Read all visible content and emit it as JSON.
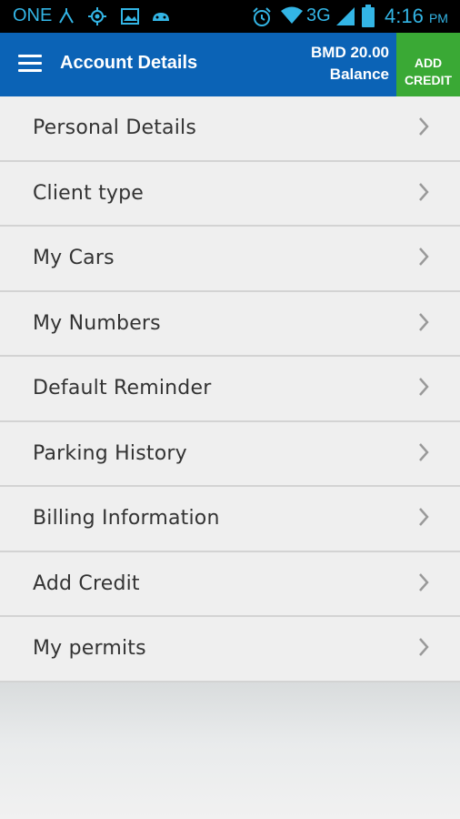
{
  "status_bar": {
    "carrier": "ONE",
    "network": "3G",
    "time": "4:16",
    "ampm": "PM"
  },
  "header": {
    "title": "Account Details",
    "balance_amount": "BMD 20.00",
    "balance_label": "Balance",
    "add_credit_line1": "ADD",
    "add_credit_line2": "CREDIT"
  },
  "menu": {
    "items": [
      {
        "label": "Personal Details"
      },
      {
        "label": "Client type"
      },
      {
        "label": "My Cars"
      },
      {
        "label": "My Numbers"
      },
      {
        "label": "Default Reminder"
      },
      {
        "label": "Parking History"
      },
      {
        "label": "Billing Information"
      },
      {
        "label": "Add Credit"
      },
      {
        "label": "My permits"
      }
    ]
  },
  "colors": {
    "app_bar": "#0b63b6",
    "add_credit": "#3aa935",
    "status_icons": "#33b5e5"
  }
}
